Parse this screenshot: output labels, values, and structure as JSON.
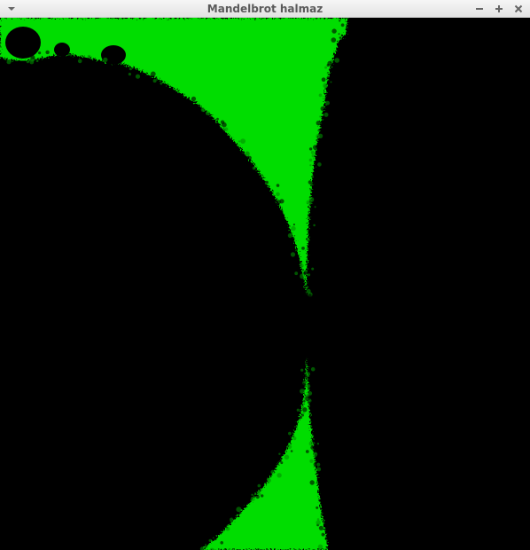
{
  "window": {
    "title": "Mandelbrot halmaz"
  },
  "icons": {
    "menu": "chevron-down-icon",
    "minimize": "minimize-icon",
    "maximize": "maximize-icon",
    "close": "close-icon"
  },
  "colors": {
    "background": "#000000",
    "fractal": "#00dd00",
    "fractal_dark": "#008f00",
    "titlebar_text": "#5a5a5a"
  }
}
